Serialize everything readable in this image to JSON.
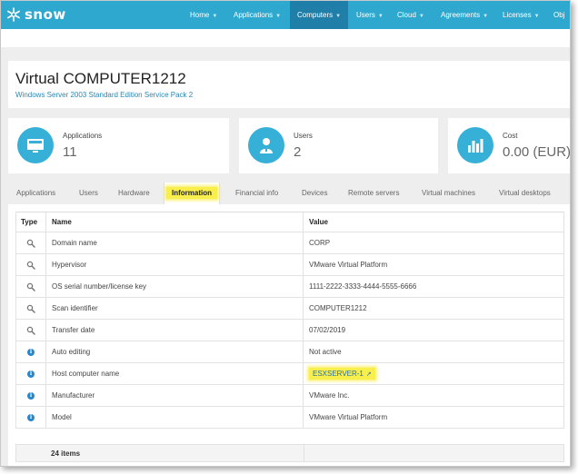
{
  "nav": {
    "logo": "snow",
    "items": [
      {
        "label": "Home",
        "active": false
      },
      {
        "label": "Applications",
        "active": false
      },
      {
        "label": "Computers",
        "active": true
      },
      {
        "label": "Users",
        "active": false
      },
      {
        "label": "Cloud",
        "active": false
      },
      {
        "label": "Agreements",
        "active": false
      },
      {
        "label": "Licenses",
        "active": false
      },
      {
        "label": "Obj",
        "active": false
      }
    ]
  },
  "header": {
    "title": "Virtual COMPUTER1212",
    "subtitle": "Windows Server 2003 Standard Edition Service Pack 2"
  },
  "stats": [
    {
      "label": "Applications",
      "value": "11",
      "icon": "monitor-icon"
    },
    {
      "label": "Users",
      "value": "2",
      "icon": "user-icon"
    },
    {
      "label": "Cost",
      "value": "0.00 (EUR)",
      "icon": "bar-chart-icon"
    }
  ],
  "tabs": [
    {
      "label": "Applications"
    },
    {
      "label": "Users"
    },
    {
      "label": "Hardware"
    },
    {
      "label": "Information",
      "active": true
    },
    {
      "label": "Financial info"
    },
    {
      "label": "Devices"
    },
    {
      "label": "Remote servers"
    },
    {
      "label": "Virtual machines"
    },
    {
      "label": "Virtual desktops"
    }
  ],
  "table": {
    "columns": [
      "Type",
      "Name",
      "Value"
    ],
    "rows": [
      {
        "type": "search",
        "name": "Domain name",
        "value": "CORP"
      },
      {
        "type": "search",
        "name": "Hypervisor",
        "value": "VMware Virtual Platform"
      },
      {
        "type": "search",
        "name": "OS serial number/license key",
        "value": "1111-2222-3333-4444-5555-6666"
      },
      {
        "type": "search",
        "name": "Scan identifier",
        "value": "COMPUTER1212"
      },
      {
        "type": "search",
        "name": "Transfer date",
        "value": "07/02/2019"
      },
      {
        "type": "info",
        "name": "Auto editing",
        "value": "Not active"
      },
      {
        "type": "info",
        "name": "Host computer name",
        "value": "ESXSERVER-1",
        "link": true
      },
      {
        "type": "info",
        "name": "Manufacturer",
        "value": "VMware Inc."
      },
      {
        "type": "info",
        "name": "Model",
        "value": "VMware Virtual Platform"
      }
    ],
    "footer": "24 items"
  },
  "colors": {
    "nav_bg": "#2fa8d0",
    "nav_active": "#1f7fa8",
    "accent_circle": "#37b0d8",
    "highlight": "#f8ee4c",
    "info_icon": "#2a87c8"
  }
}
